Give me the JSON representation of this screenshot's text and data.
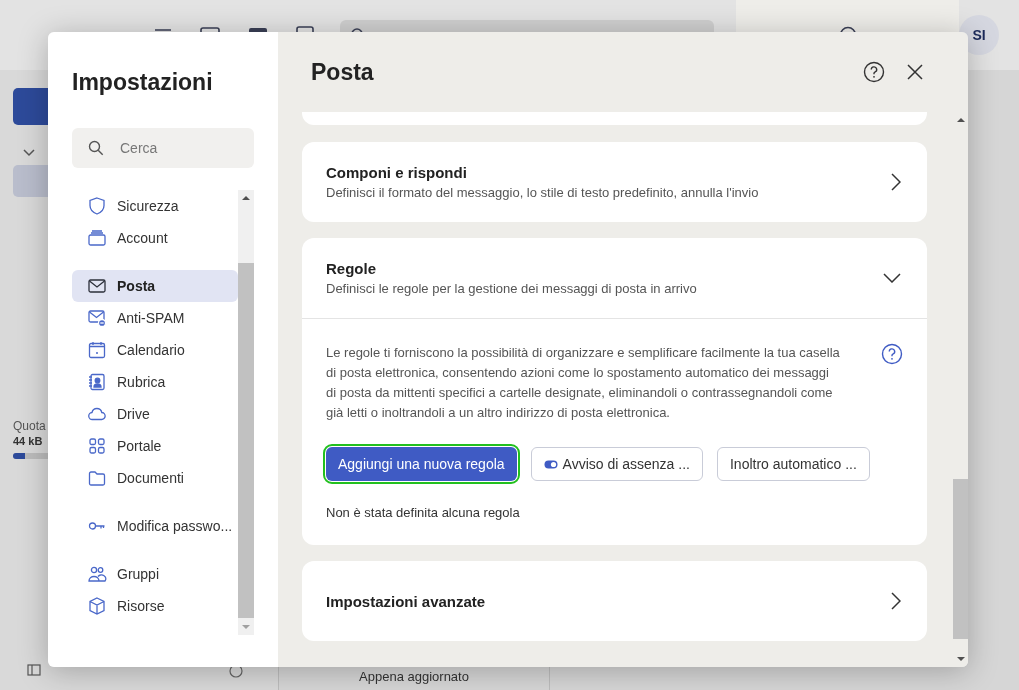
{
  "app": {
    "avatar": "SI",
    "quota_label": "Quota",
    "quota_value": "44 kB",
    "quota": {
      "level": 0.05
    },
    "status": "Appena aggiornato"
  },
  "settings": {
    "title": "Impostazioni",
    "search": {
      "placeholder": "Cerca"
    },
    "nav_groups": [
      {
        "items": [
          {
            "label": "Sicurezza",
            "selected": false
          },
          {
            "label": "Account",
            "selected": false
          }
        ]
      },
      {
        "items": [
          {
            "label": "Posta",
            "selected": true
          },
          {
            "label": "Anti-SPAM",
            "selected": false
          },
          {
            "label": "Calendario",
            "selected": false
          },
          {
            "label": "Rubrica",
            "selected": false
          },
          {
            "label": "Drive",
            "selected": false
          },
          {
            "label": "Portale",
            "selected": false
          },
          {
            "label": "Documenti",
            "selected": false
          }
        ]
      },
      {
        "items": [
          {
            "label": "Modifica passwo...",
            "selected": false
          }
        ]
      },
      {
        "items": [
          {
            "label": "Gruppi",
            "selected": false
          },
          {
            "label": "Risorse",
            "selected": false
          }
        ]
      }
    ],
    "panel": {
      "title": "Posta",
      "sections": [
        {
          "title": "Componi e rispondi",
          "description": "Definisci il formato del messaggio, lo stile di testo predefinito, annulla l'invio",
          "expanded": false
        },
        {
          "title": "Regole",
          "description": "Definisci le regole per la gestione dei messaggi di posta in arrivo",
          "expanded": true,
          "body": "Le regole ti forniscono la possibilità di organizzare e semplificare facilmente la tua casella di posta elettronica, consentendo azioni come lo spostamento automatico dei messaggi di posta da mittenti specifici a cartelle designate, eliminandoli o contrassegnandoli come già letti o inoltrandoli a un altro indirizzo di posta elettronica.",
          "buttons": [
            {
              "label": "Aggiungi una nuova regola",
              "kind": "primary",
              "focused": true
            },
            {
              "label": "Avviso di assenza ...",
              "kind": "toggle",
              "focused": false
            },
            {
              "label": "Inoltro automatico ...",
              "kind": "plain",
              "focused": false
            }
          ],
          "empty": "Non è stata definita alcuna regola"
        },
        {
          "title": "Impostazioni avanzate",
          "expanded": false
        }
      ]
    }
  }
}
